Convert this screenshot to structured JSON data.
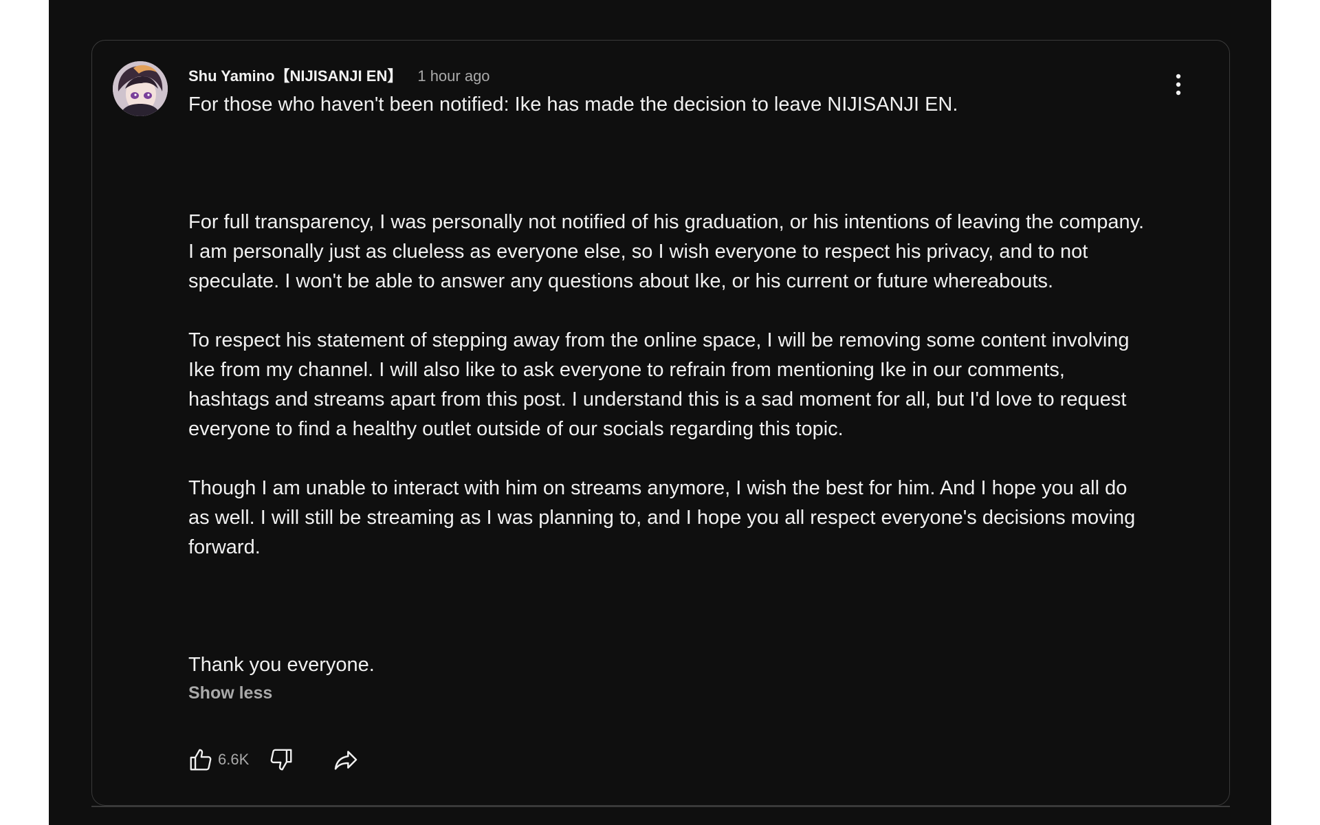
{
  "comment": {
    "author": "Shu Yamino【NIJISANJI EN】",
    "timestamp": "1 hour ago",
    "paragraphs": [
      "For those who haven't been notified: Ike has made the decision to leave NIJISANJI EN.",
      "For full transparency, I was personally not notified of his graduation, or his intentions of leaving the company. I am personally just as clueless as everyone else, so I wish everyone to respect his privacy, and to not speculate. I won't be able to answer any questions about Ike, or his current or future whereabouts.",
      "To respect his statement of stepping away from the online space, I will be removing some content involving Ike from my channel. I will also like to ask everyone to refrain from mentioning Ike in our comments, hashtags and streams apart from this post. I understand this is a sad moment for all, but I'd love to request everyone to find a healthy outlet outside of our socials regarding this topic.",
      "Though I am unable to interact with him on streams anymore, I wish the best for him. And I hope you all do as well. I will still be streaming as I was planning to, and I hope you all respect everyone's decisions moving forward.",
      "Thank you everyone."
    ],
    "show_less_label": "Show less",
    "like_count": "6.6K"
  },
  "icons": {
    "avatar": "avatar-image",
    "more": "more-vert-icon",
    "like": "thumbs-up-icon",
    "dislike": "thumbs-down-icon",
    "share": "share-icon"
  },
  "colors": {
    "background": "#0f0f0f",
    "text_primary": "#f1f1f1",
    "text_secondary": "#aaaaaa",
    "border": "#3a3a3a"
  }
}
